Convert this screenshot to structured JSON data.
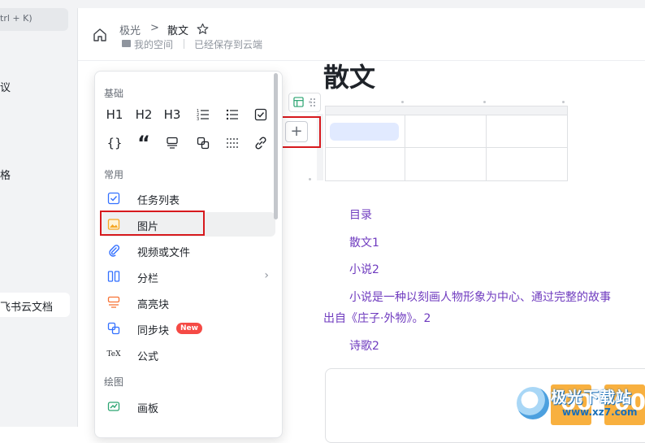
{
  "sidebar": {
    "search_hint": "trl + K)",
    "items": [
      "议",
      "格"
    ],
    "active_item": "飞书云文档"
  },
  "header": {
    "breadcrumb_root": "极光",
    "breadcrumb_sep": ">",
    "breadcrumb_current": "散文",
    "space": "我的空间",
    "save_status": "已经保存到云端"
  },
  "doc": {
    "title": "散文",
    "toc_title": "目录",
    "toc_items": [
      "散文1",
      "小说2"
    ],
    "paragraph_line1": "小说是一种以刻画人物形象为中心、通过完整的故事",
    "paragraph_line2": "出自《庄子·外物》。2",
    "toc_item3": "诗歌2"
  },
  "table": {
    "add_button": "+"
  },
  "insert_menu": {
    "section_basic": "基础",
    "basic_icons": [
      {
        "label": "H1",
        "icon": "heading-1-icon"
      },
      {
        "label": "H2",
        "icon": "heading-2-icon"
      },
      {
        "label": "H3",
        "icon": "heading-3-icon"
      },
      {
        "label": "",
        "icon": "ordered-list-icon"
      },
      {
        "label": "",
        "icon": "bullet-list-icon"
      },
      {
        "label": "",
        "icon": "checkbox-icon"
      },
      {
        "label": "{}",
        "icon": "code-block-icon"
      },
      {
        "label": "“",
        "icon": "quote-icon"
      },
      {
        "label": "",
        "icon": "callout-icon"
      },
      {
        "label": "",
        "icon": "sync-icon"
      },
      {
        "label": "",
        "icon": "divider-icon"
      },
      {
        "label": "",
        "icon": "link-icon"
      }
    ],
    "section_common": "常用",
    "items": [
      {
        "label": "任务列表",
        "icon": "task-list-icon"
      },
      {
        "label": "图片",
        "icon": "image-icon"
      },
      {
        "label": "视频或文件",
        "icon": "attachment-icon"
      },
      {
        "label": "分栏",
        "icon": "columns-icon",
        "chevron": "›"
      },
      {
        "label": "高亮块",
        "icon": "highlight-block-icon"
      },
      {
        "label": "同步块",
        "icon": "sync-block-icon",
        "badge": "New"
      },
      {
        "label": "公式",
        "icon": "formula-icon",
        "icon_text": "TeX"
      }
    ],
    "section_draw": "绘图",
    "draw_items": [
      {
        "label": "画板",
        "icon": "whiteboard-icon"
      }
    ]
  },
  "watermark": {
    "name": "极光下载站",
    "url": "www.xz7.com",
    "digits": [
      "00",
      "00"
    ]
  },
  "colors": {
    "accent_blue": "#3370ff",
    "link_purple": "#6f3bbf",
    "highlight_red": "#d7191d",
    "badge_red": "#f54a45"
  }
}
